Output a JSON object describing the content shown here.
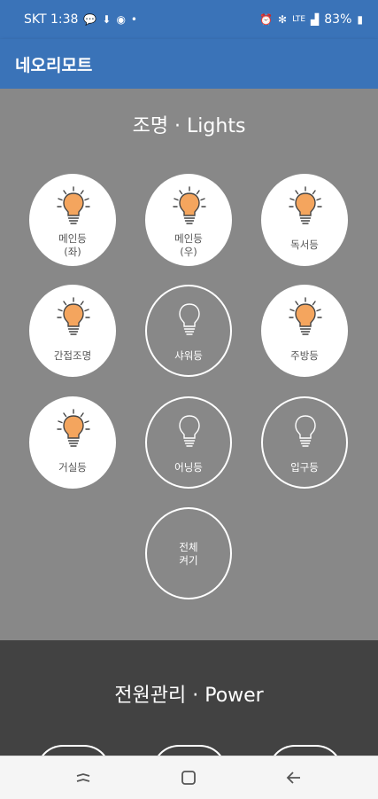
{
  "status": {
    "carrier_time": "SKT 1:38",
    "network": "LTE",
    "battery": "83%"
  },
  "app": {
    "title": "네오리모트"
  },
  "lights": {
    "title": "조명 · Lights",
    "buttons": [
      {
        "label": "메인등\n(좌)",
        "on": true
      },
      {
        "label": "메인등\n(우)",
        "on": true
      },
      {
        "label": "독서등",
        "on": true
      },
      {
        "label": "간접조명",
        "on": true
      },
      {
        "label": "샤워등",
        "on": false
      },
      {
        "label": "주방등",
        "on": true
      },
      {
        "label": "거실등",
        "on": true
      },
      {
        "label": "어닝등",
        "on": false
      },
      {
        "label": "입구등",
        "on": false
      }
    ],
    "all_button": "전체\n켜기"
  },
  "power": {
    "title": "전원관리 · Power"
  },
  "colors": {
    "appbar": "#3a73b8",
    "bulb_on": "#f4a55e",
    "lights_bg": "#888888",
    "power_bg": "#424242"
  },
  "icons": {
    "bulb_on": "lightbulb-on-icon",
    "bulb_off": "lightbulb-outline-icon"
  }
}
